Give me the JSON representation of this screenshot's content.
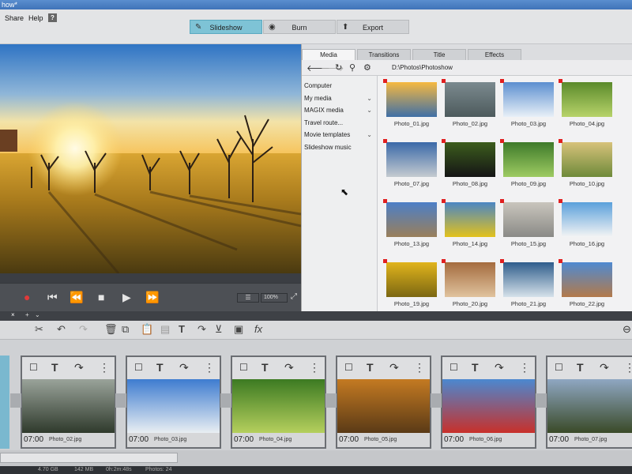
{
  "window": {
    "title": "how*"
  },
  "menu": {
    "share": "Share",
    "help": "Help",
    "help_icon": "?"
  },
  "modes": {
    "slideshow": "Slideshow",
    "burn": "Burn",
    "export": "Export",
    "active": "slideshow"
  },
  "media_panel": {
    "tabs": [
      "Media",
      "Transitions",
      "Title",
      "Effects"
    ],
    "active_tab": "Media",
    "path": "D:\\Photos\\Photoshow",
    "tree": [
      {
        "label": "Computer",
        "expand": ""
      },
      {
        "label": "My media",
        "expand": "⌄"
      },
      {
        "label": "MAGIX media",
        "expand": "⌄"
      },
      {
        "label": "Travel route...",
        "expand": ""
      },
      {
        "label": "Movie templates",
        "expand": "⌄"
      },
      {
        "label": "Slideshow music",
        "expand": ""
      }
    ],
    "thumbnails": [
      "Photo_01.jpg",
      "Photo_02.jpg",
      "Photo_03.jpg",
      "Photo_04.jpg",
      "Photo_07.jpg",
      "Photo_08.jpg",
      "Photo_09.jpg",
      "Photo_10.jpg",
      "Photo_13.jpg",
      "Photo_14.jpg",
      "Photo_15.jpg",
      "Photo_16.jpg",
      "Photo_19.jpg",
      "Photo_20.jpg",
      "Photo_21.jpg",
      "Photo_22.jpg"
    ]
  },
  "transport": {
    "zoom": "100%",
    "list": "☰"
  },
  "timeline": {
    "tab_close": "×",
    "tab_add": "+",
    "clips": [
      {
        "duration": "07:00",
        "name": "Photo_02.jpg"
      },
      {
        "duration": "07:00",
        "name": "Photo_03.jpg"
      },
      {
        "duration": "07:00",
        "name": "Photo_04.jpg"
      },
      {
        "duration": "07:00",
        "name": "Photo_05.jpg"
      },
      {
        "duration": "07:00",
        "name": "Photo_06.jpg"
      },
      {
        "duration": "07:00",
        "name": "Photo_07.jpg"
      }
    ]
  },
  "status": {
    "disk": "4.70 GB",
    "size": "142 MB",
    "time": "0h:2m:48s",
    "photos": "Photos: 24"
  }
}
